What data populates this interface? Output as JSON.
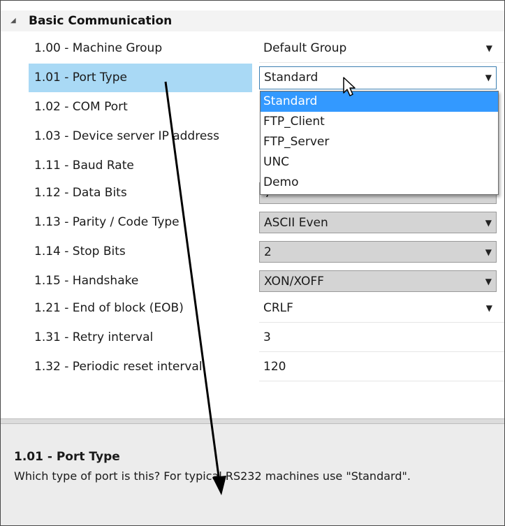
{
  "category": {
    "label": "Basic Communication",
    "toggle_icon": "collapse-triangle-icon"
  },
  "properties": [
    {
      "name": "1.00 - Machine Group",
      "value": "Default Group",
      "dropdown": true
    },
    {
      "name": "1.01 - Port Type",
      "value": "Standard",
      "dropdown": true,
      "selected": true
    },
    {
      "name": "1.02 - COM Port",
      "value": ""
    },
    {
      "name": "1.03 - Device server IP address",
      "value": ""
    },
    {
      "name": "1.11 - Baud Rate",
      "value": ""
    },
    {
      "name": "1.12 - Data Bits",
      "value": "7"
    },
    {
      "name": "1.13 - Parity / Code Type",
      "value": "ASCII Even",
      "dropdown": true
    },
    {
      "name": "1.14 - Stop Bits",
      "value": "2",
      "dropdown": true
    },
    {
      "name": "1.15 - Handshake",
      "value": "XON/XOFF",
      "dropdown": true
    },
    {
      "name": "1.21 - End of block (EOB)",
      "value": "CRLF",
      "dropdown": true
    },
    {
      "name": "1.31 - Retry interval",
      "value": "3"
    },
    {
      "name": "1.32 - Periodic reset interval",
      "value": "120"
    }
  ],
  "dropdown_options": [
    "Standard",
    "FTP_Client",
    "FTP_Server",
    "UNC",
    "Demo"
  ],
  "dropdown_selected": "Standard",
  "dropdown_arrow_glyph": "▼",
  "description": {
    "title": "1.01 - Port Type",
    "text": "Which type of port is this? For typical RS232 machines use \"Standard\"."
  },
  "colors": {
    "selected_row": "#a9d9f5",
    "dropdown_highlight": "#3399ff",
    "description_bg": "#ececec"
  },
  "icons": {
    "cursor": "mouse-pointer-icon",
    "annotation": "annotation-arrow-icon"
  }
}
